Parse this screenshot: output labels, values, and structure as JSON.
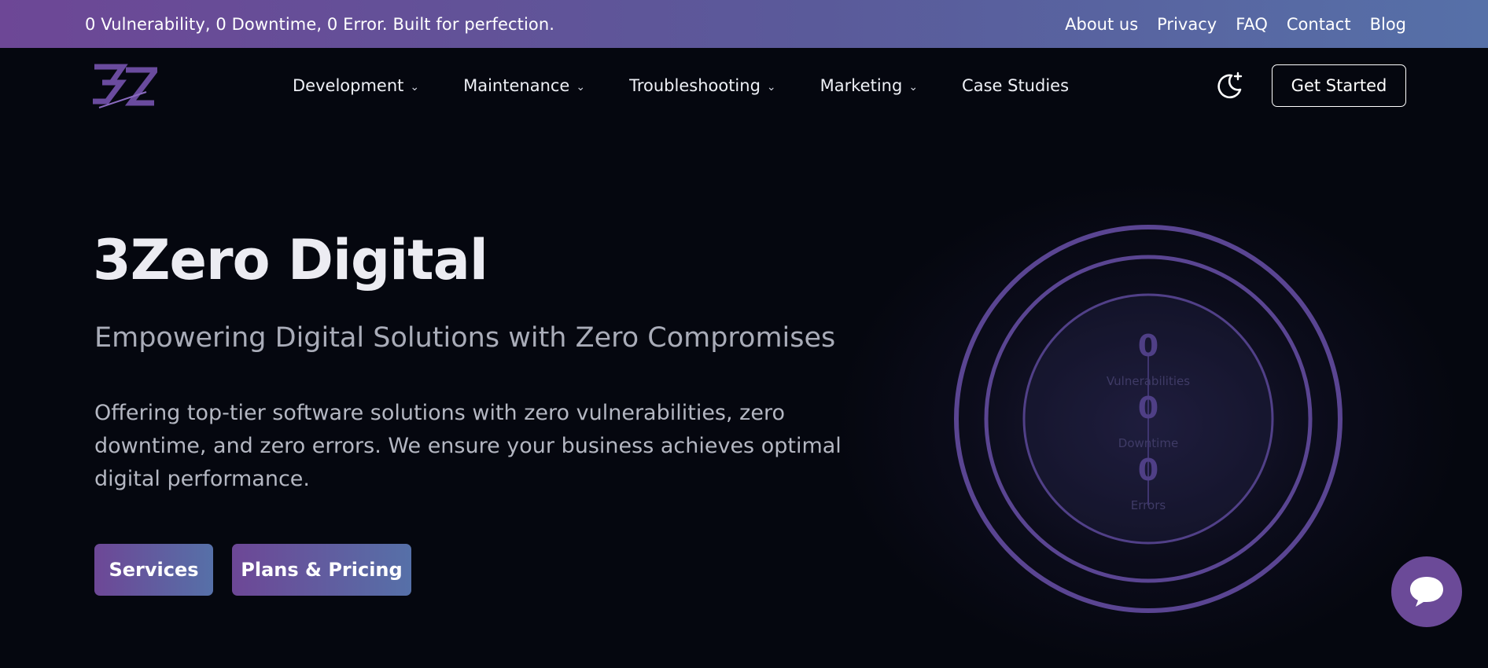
{
  "topbar": {
    "tagline": "0 Vulnerability, 0 Downtime, 0 Error. Built for perfection.",
    "links": [
      "About us",
      "Privacy",
      "FAQ",
      "Contact",
      "Blog"
    ]
  },
  "nav": {
    "logo_icon": "3z-logo-icon",
    "menu": [
      {
        "label": "Development",
        "has_dropdown": true
      },
      {
        "label": "Maintenance",
        "has_dropdown": true
      },
      {
        "label": "Troubleshooting",
        "has_dropdown": true
      },
      {
        "label": "Marketing",
        "has_dropdown": true
      },
      {
        "label": "Case Studies",
        "has_dropdown": false
      }
    ],
    "theme_icon": "moon-sparkle-icon",
    "cta_label": "Get Started"
  },
  "hero": {
    "title": "3Zero Digital",
    "subtitle": "Empowering Digital Solutions with Zero Compromises",
    "description": "Offering top-tier software solutions with zero vulnerabilities, zero downtime, and zero errors. We ensure your business achieves optimal digital performance.",
    "buttons": {
      "services": "Services",
      "pricing": "Plans & Pricing"
    }
  },
  "stats": [
    {
      "value": "0",
      "label": "Vulnerabilities"
    },
    {
      "value": "0",
      "label": "Downtime"
    },
    {
      "value": "0",
      "label": "Errors"
    }
  ],
  "chat": {
    "icon": "chat-bubble-icon"
  },
  "colors": {
    "accent_purple": "#6d4796",
    "accent_blue": "#5670a8",
    "background": "#05070f",
    "ring": "#5a4592"
  }
}
